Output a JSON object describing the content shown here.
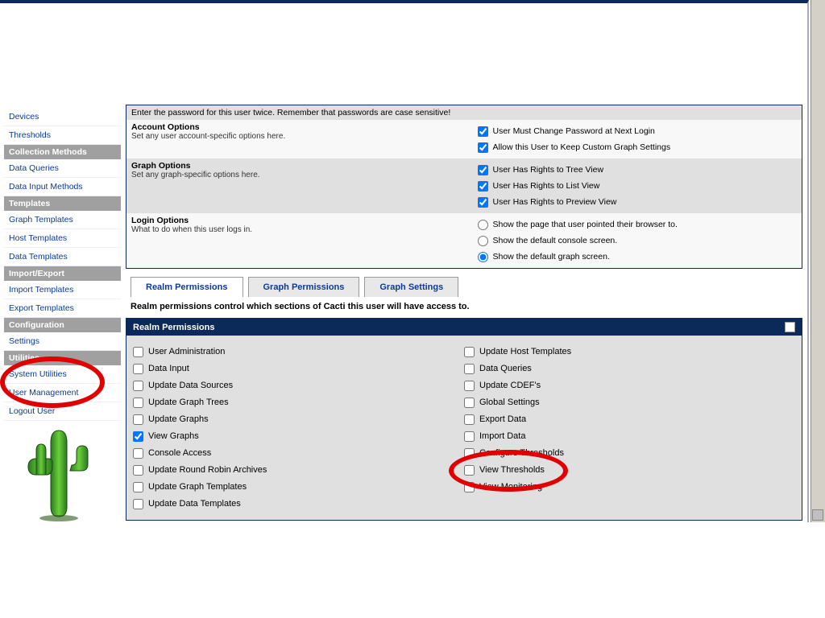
{
  "sidebar": {
    "sections": [
      {
        "type": "link",
        "label": "Devices"
      },
      {
        "type": "link",
        "label": "Thresholds"
      },
      {
        "type": "hdr",
        "label": "Collection Methods"
      },
      {
        "type": "link",
        "label": "Data Queries"
      },
      {
        "type": "link",
        "label": "Data Input Methods"
      },
      {
        "type": "hdr",
        "label": "Templates"
      },
      {
        "type": "link",
        "label": "Graph Templates"
      },
      {
        "type": "link",
        "label": "Host Templates"
      },
      {
        "type": "link",
        "label": "Data Templates"
      },
      {
        "type": "hdr",
        "label": "Import/Export"
      },
      {
        "type": "link",
        "label": "Import Templates"
      },
      {
        "type": "link",
        "label": "Export Templates"
      },
      {
        "type": "hdr",
        "label": "Configuration"
      },
      {
        "type": "link",
        "label": "Settings"
      },
      {
        "type": "hdr",
        "label": "Utilities"
      },
      {
        "type": "link",
        "label": "System Utilities"
      },
      {
        "type": "link",
        "label": "User Management"
      },
      {
        "type": "link",
        "label": "Logout User"
      }
    ]
  },
  "form": {
    "password_note": "Enter the password for this user twice. Remember that passwords are case sensitive!",
    "account_options_title": "Account Options",
    "account_options_sub": "Set any user account-specific options here.",
    "acct_opt1": "User Must Change Password at Next Login",
    "acct_opt2": "Allow this User to Keep Custom Graph Settings",
    "graph_options_title": "Graph Options",
    "graph_options_sub": "Set any graph-specific options here.",
    "graph_opt1": "User Has Rights to Tree View",
    "graph_opt2": "User Has Rights to List View",
    "graph_opt3": "User Has Rights to Preview View",
    "login_options_title": "Login Options",
    "login_options_sub": "What to do when this user logs in.",
    "login_opt1": "Show the page that user pointed their browser to.",
    "login_opt2": "Show the default console screen.",
    "login_opt3": "Show the default graph screen."
  },
  "tabs": {
    "realm": "Realm Permissions",
    "graph": "Graph Permissions",
    "settings": "Graph Settings"
  },
  "desc": "Realm permissions control which sections of Cacti this user will have access to.",
  "realm_hdr": "Realm Permissions",
  "realm_left": [
    {
      "label": "User Administration",
      "checked": false
    },
    {
      "label": "Data Input",
      "checked": false
    },
    {
      "label": "Update Data Sources",
      "checked": false
    },
    {
      "label": "Update Graph Trees",
      "checked": false
    },
    {
      "label": "Update Graphs",
      "checked": false
    },
    {
      "label": "View Graphs",
      "checked": true
    },
    {
      "label": "Console Access",
      "checked": false
    },
    {
      "label": "Update Round Robin Archives",
      "checked": false
    },
    {
      "label": "Update Graph Templates",
      "checked": false
    },
    {
      "label": "Update Data Templates",
      "checked": false
    }
  ],
  "realm_right": [
    {
      "label": "Update Host Templates",
      "checked": false
    },
    {
      "label": "Data Queries",
      "checked": false
    },
    {
      "label": "Update CDEF's",
      "checked": false
    },
    {
      "label": "Global Settings",
      "checked": false
    },
    {
      "label": "Export Data",
      "checked": false
    },
    {
      "label": "Import Data",
      "checked": false
    },
    {
      "label": "Configure Thresholds",
      "checked": false
    },
    {
      "label": "View Thresholds",
      "checked": false
    },
    {
      "label": "View Monitoring",
      "checked": false
    }
  ]
}
